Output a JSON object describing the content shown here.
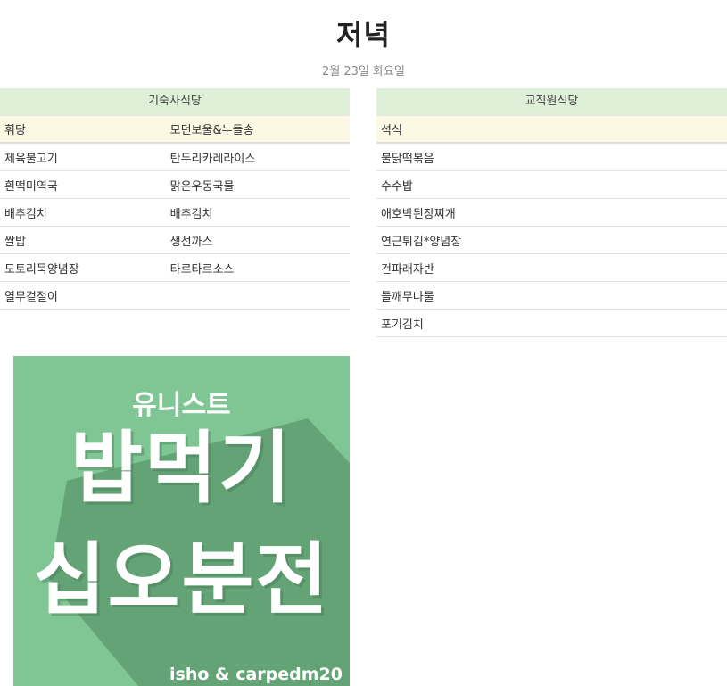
{
  "page": {
    "title": "저녁",
    "date": "2월 23일 화요일"
  },
  "dormitory": {
    "name": "기숙사식당",
    "columns": [
      "휘당",
      "모던보울&누들송"
    ],
    "rows": [
      [
        "제육불고기",
        "탄두리카레라이스"
      ],
      [
        "흰떡미역국",
        "맑은우동국물"
      ],
      [
        "배추김치",
        "배추김치"
      ],
      [
        "쌀밥",
        "생선까스"
      ],
      [
        "도토리묵양념장",
        "타르타르소스"
      ],
      [
        "열무겉절이",
        ""
      ]
    ]
  },
  "staff": {
    "name": "교직원식당",
    "columns": [
      "석식"
    ],
    "rows": [
      [
        "불닭떡볶음"
      ],
      [
        "수수밥"
      ],
      [
        "애호박된장찌개"
      ],
      [
        "연근튀김*양념장"
      ],
      [
        "건파래자반"
      ],
      [
        "들깨무나물"
      ],
      [
        "포기김치"
      ]
    ]
  },
  "banner": {
    "subtitle": "유니스트",
    "line1": "밥먹기",
    "line2": "십오분전",
    "credit": "isho & carpedm20",
    "colors": {
      "background": "#7fc694",
      "shadow": "#64a376",
      "text": "#ffffff"
    }
  }
}
